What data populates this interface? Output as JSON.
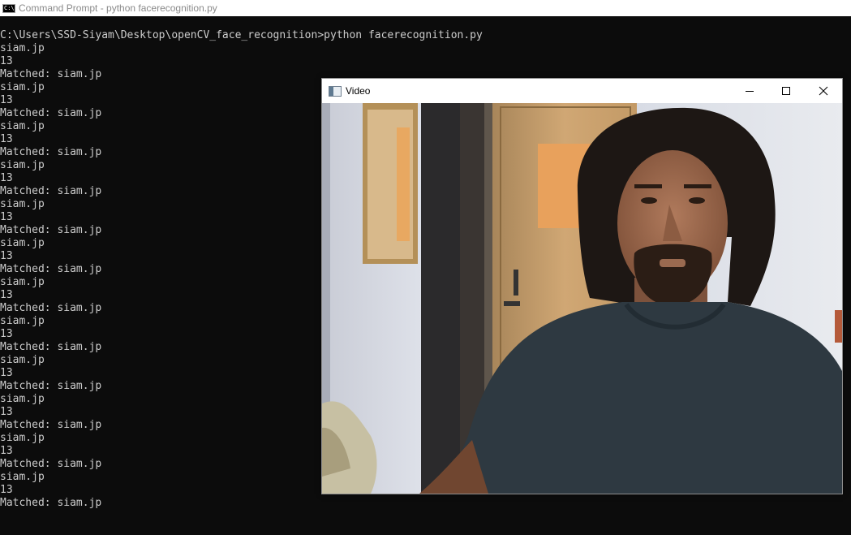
{
  "console": {
    "title": "Command Prompt - python  facerecognition.py",
    "lines": [
      "C:\\Users\\SSD-Siyam\\Desktop\\openCV_face_recognition>python facerecognition.py",
      "siam.jp",
      "13",
      "Matched: siam.jp",
      "siam.jp",
      "13",
      "Matched: siam.jp",
      "siam.jp",
      "13",
      "Matched: siam.jp",
      "siam.jp",
      "13",
      "Matched: siam.jp",
      "siam.jp",
      "13",
      "Matched: siam.jp",
      "siam.jp",
      "13",
      "Matched: siam.jp",
      "siam.jp",
      "13",
      "Matched: siam.jp",
      "siam.jp",
      "13",
      "Matched: siam.jp",
      "siam.jp",
      "13",
      "Matched: siam.jp",
      "siam.jp",
      "13",
      "Matched: siam.jp",
      "siam.jp",
      "13",
      "Matched: siam.jp",
      "siam.jp",
      "13",
      "Matched: siam.jp"
    ],
    "colors": {
      "background": "#0c0c0c",
      "text": "#cccccc",
      "titlebar": "#ffffff",
      "title_text": "#8a8a8a"
    }
  },
  "video_window": {
    "title": "Video",
    "icons": {
      "minimize": "minimize-icon",
      "maximize": "maximize-icon",
      "close": "close-icon"
    }
  }
}
